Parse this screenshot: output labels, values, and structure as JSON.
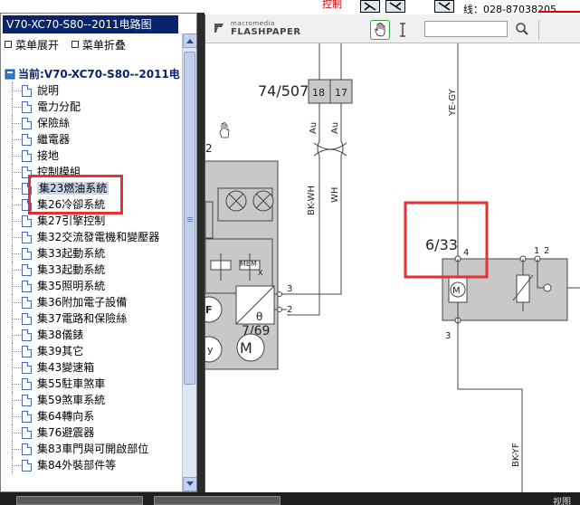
{
  "sidebar": {
    "title": "V70-XC70-S80--2011电路图",
    "actions": [
      "菜单展开",
      "菜单折叠"
    ],
    "current_node": "当前:V70-XC70-S80--2011电",
    "items": [
      {
        "label": "說明"
      },
      {
        "label": "電力分配"
      },
      {
        "label": "保險絲"
      },
      {
        "label": "繼電器"
      },
      {
        "label": "接地"
      },
      {
        "label": "控制模組"
      },
      {
        "label": "集23燃油系統"
      },
      {
        "label": "集26冷卻系統"
      },
      {
        "label": "集27引擎控制"
      },
      {
        "label": "集32交流發電機和變壓器"
      },
      {
        "label": "集33起動系統"
      },
      {
        "label": "集33起動系統"
      },
      {
        "label": "集35照明系統"
      },
      {
        "label": "集36附加電子設備"
      },
      {
        "label": "集37電路和保險絲"
      },
      {
        "label": "集38儀錶"
      },
      {
        "label": "集39其它"
      },
      {
        "label": "集43變速箱"
      },
      {
        "label": "集55駐車煞車"
      },
      {
        "label": "集59煞車系統"
      },
      {
        "label": "集64轉向系"
      },
      {
        "label": "集76避震器"
      },
      {
        "label": "集83車門與可開啟部位"
      },
      {
        "label": "集84外裝部件等"
      }
    ],
    "selected_index": 6
  },
  "top_strip": {
    "text1": "控制",
    "text2": "线：028-87038205"
  },
  "viewer": {
    "brand_top": "macromedia",
    "brand_main": "FLASHPAPER",
    "search_placeholder": ""
  },
  "diagram": {
    "connector_label": "74/507",
    "pin_a": "18",
    "pin_b": "17",
    "wire_au1": "Au",
    "wire_au2": "Au",
    "wire_bkwh": "BK-WH",
    "wire_wh": "WH",
    "wire_yegy": "YE-GY",
    "wire_bkyf": "BK-YF",
    "component_label": "6/33",
    "pin4": "4",
    "pin3_right": "3",
    "pin2_right": "2",
    "pin1_right": "1",
    "module_label": "7/69",
    "pin3_left": "3",
    "pin2_left": "2",
    "module_num": "2",
    "mem_label": "MEM",
    "mem_x": "X",
    "theta": "θ",
    "f_label": "F",
    "y_label": "y",
    "mx_label": "M"
  },
  "taskbar": {
    "right_label": "视图"
  },
  "colors": {
    "title_bar": "#0a246a",
    "highlight": "#e53131",
    "component_fill": "#c8c8c8"
  }
}
